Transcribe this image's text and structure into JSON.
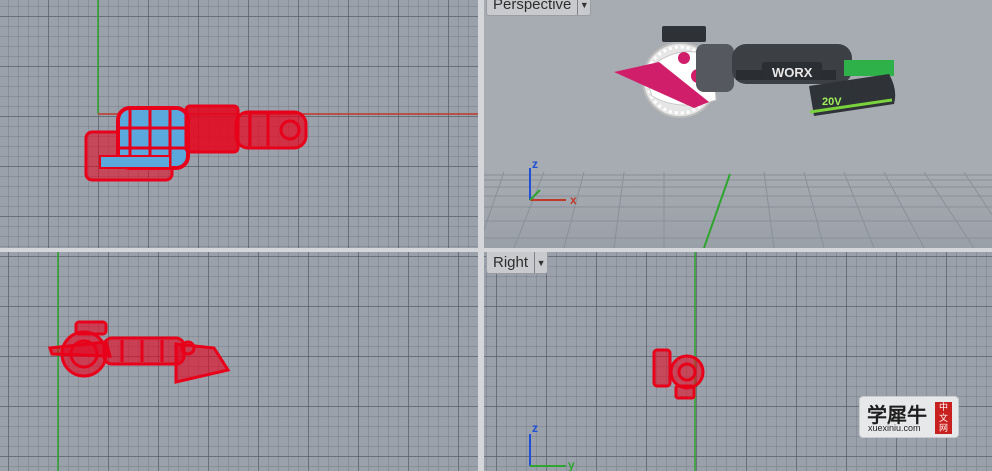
{
  "viewports": {
    "top": {
      "name": ""
    },
    "perspective": {
      "name": "Perspective"
    },
    "front": {
      "name": ""
    },
    "right": {
      "name": "Right"
    }
  },
  "axes": {
    "x": "x",
    "y": "y",
    "z": "z"
  },
  "tool_brand": "WORX",
  "battery_label": "20V",
  "watermark": {
    "text": "学犀牛",
    "seal": [
      "中",
      "文",
      "网"
    ],
    "url": "xuexiniu.com"
  },
  "colors": {
    "wireframe": "#e8001a",
    "world_x": "#c0392b",
    "world_y": "#2fa52f",
    "world_z": "#1f4fd6",
    "viewport_bg": "#9ba1aa"
  }
}
